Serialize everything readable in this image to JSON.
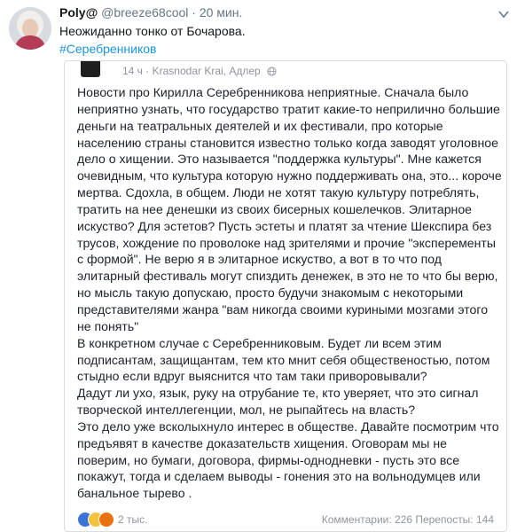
{
  "tweet": {
    "display_name": "Poly@",
    "handle": "@breeze68cool",
    "separator": "·",
    "time": "20 мин.",
    "text": "Неожиданно тонко от Бочарова.",
    "hashtag": "#Серебренников"
  },
  "fb_post": {
    "time": "14 ч",
    "separator": "·",
    "location": "Krasnodar Krai, Адлер",
    "lines": [
      "Новости про Кирилла Серебренникова неприятные. Сначала было",
      "неприятно узнать, что государство тратит какие-то неприлично большие",
      "деньги на театральных деятелей и их фестивали, про которые",
      "населению страны становится известно только когда заводят уголовное",
      "дело о хищении. Это называется \"поддержка культуры\". Мне кажется",
      "очевидным, что культура которую нужно поддерживать она, это... короче",
      "мертва. Сдохла, в общем. Люди не хотят такую культуру потреблять,",
      "тратить на нее денешки из своих бисерных кошелечков. Элитарное",
      "искуство? Для эстетов? Пусть эстеты и платят за чтение Шекспира без",
      "трусов, хождение по проволоке над зрителями и прочие \"эксперементы",
      "с формой\". Не верю я в элитарное искуство, а вот в то что под",
      "элитарный фестиваль могут спиздить денежек, в это не то что бы верю,",
      "но мысль такую допускаю, просто будучи знакомым с некоторыми",
      "представителями жанра \"вам никогда своими куриными мозгами этого",
      "не понять\"",
      "В конкретном случае с Серебренниковым. Будет ли всем этим",
      "подписантам, защищантам, тем кто мнит себя общественостью, потом",
      "стыдно если вдруг выяснится что там таки приворовывали?",
      "Дадут ли ухо, язык, руку на отрубание те, кто уверяет, что это сигнал",
      "творческой интеллегенции, мол, не рыпайтесь на власть?",
      "Это дело уже всколыхнуло интерес в обществе. Давайте посмотрим что",
      "предъявят в качестве доказательств хищения. Оговорам мы не",
      "поверим, но бумаги, договора, фирмы-однодневки - пусть это все",
      "покажут, тогда и сделаем выводы - гонения это на вольнодумцев или",
      "банальное тырево ."
    ],
    "footer": {
      "reactions_count": "2 тыс.",
      "stats": "Комментарии: 226   Перепосты: 144"
    }
  },
  "colors": {
    "link": "#1b95e0",
    "meta_gray": "#657786",
    "fb_text": "#1d2129",
    "fb_meta": "#90949c"
  },
  "icons": [
    "avatar",
    "caret-down-icon",
    "globe-icon",
    "like-reaction-icon",
    "haha-reaction-icon",
    "angry-reaction-icon"
  ]
}
